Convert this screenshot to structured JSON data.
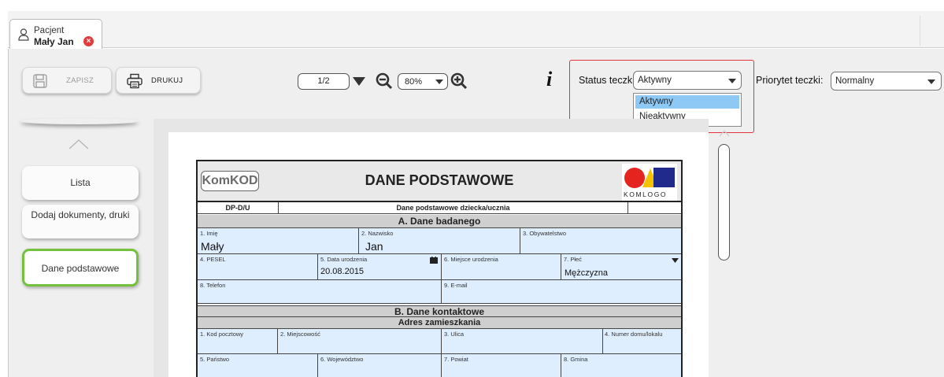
{
  "tab": {
    "line1": "Pacjent",
    "line2": "Mały Jan",
    "close_icon": "close-icon"
  },
  "toolbar": {
    "save_label": "ZAPISZ",
    "print_label": "DRUKUJ",
    "page_value": "1/2",
    "zoom_value": "80%",
    "status_label": "Status teczki:",
    "status_value": "Aktywny",
    "status_options": [
      "Aktywny",
      "Nieaktywny"
    ],
    "priority_label": "Priorytet teczki:",
    "priority_value": "Normalny"
  },
  "nav": {
    "items": [
      "Lista",
      "Dodaj dokumenty, druki",
      "Dane podstawowe"
    ],
    "active": "Dane podstawowe"
  },
  "form": {
    "logo_left": "KomKOD",
    "title": "DANE PODSTAWOWE",
    "logo_right": "KOMLOGO",
    "code": "DP-D/U",
    "subtitle": "Dane podstawowe dziecka/ucznia",
    "section_a": "A. Dane badanego",
    "f_imie_label": "1. Imię",
    "f_imie_value": "Mały",
    "f_nazwisko_label": "2. Nazwisko",
    "f_nazwisko_value": "Jan",
    "f_obywatelstwo_label": "3. Obywatelstwo",
    "f_pesel_label": "4. PESEL",
    "f_data_label": "5. Data urodzenia",
    "f_data_value": "20.08.2015",
    "f_miejsce_label": "6. Miejsce urodzenia",
    "f_plec_label": "7. Płeć",
    "f_plec_value": "Mężczyzna",
    "f_telefon_label": "8. Telefon",
    "f_email_label": "9. E-mail",
    "section_b": "B. Dane kontaktowe",
    "section_b_sub": "Adres zamieszkania",
    "f_kod_label": "1. Kod pocztowy",
    "f_miejscowosc_label": "2. Miejscowość",
    "f_ulica_label": "3. Ulica",
    "f_numer_label": "4. Numer domu/lokalu",
    "f_panstwo_label": "5. Państwo",
    "f_woj_label": "6. Województwo",
    "f_powiat_label": "7. Powiat",
    "f_gmina_label": "8. Gmina"
  },
  "colors": {
    "accent_green": "#73c13c",
    "status_frame": "#e2333c",
    "field_bg": "#deeeff",
    "close": "#e23b3b"
  }
}
